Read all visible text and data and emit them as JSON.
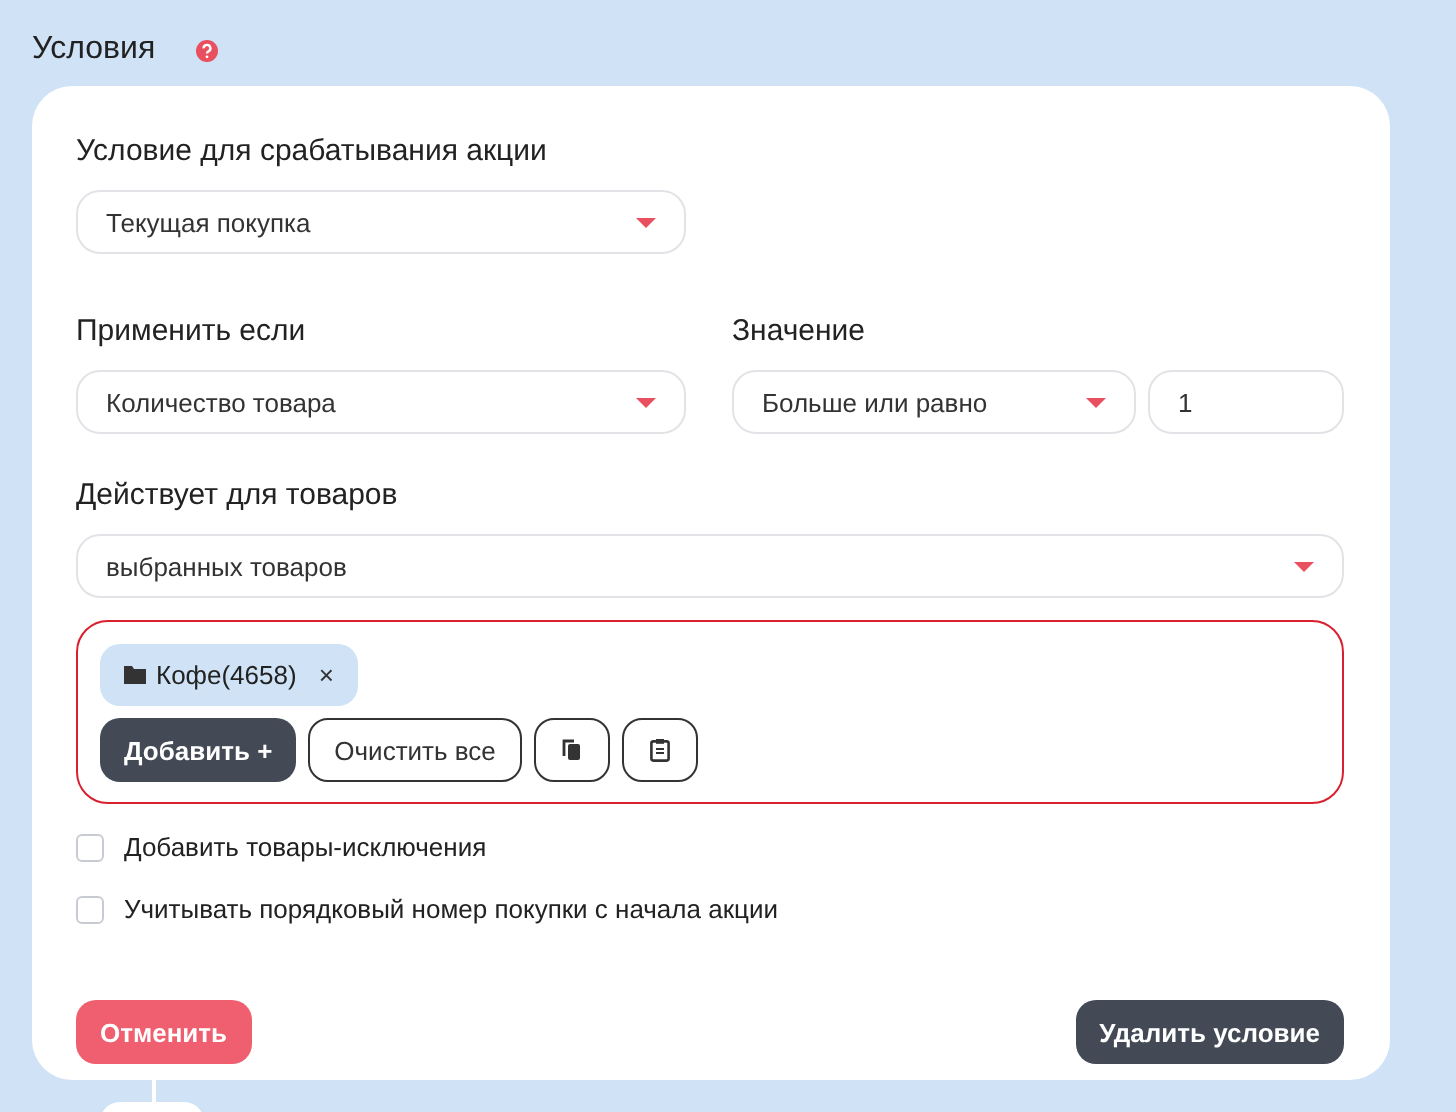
{
  "section": {
    "title": "Условия"
  },
  "trigger": {
    "label": "Условие для срабатывания акции",
    "value": "Текущая покупка"
  },
  "apply_if": {
    "label": "Применить если",
    "value": "Количество товара"
  },
  "value": {
    "label": "Значение",
    "operator": "Больше или равно",
    "amount": "1"
  },
  "products": {
    "label": "Действует для товаров",
    "value": "выбранных товаров",
    "tags": [
      {
        "text": "Кофе(4658)",
        "remove": "×"
      }
    ],
    "add_button": "Добавить +",
    "clear_button": "Очистить все"
  },
  "options": [
    {
      "label": "Добавить товары-исключения",
      "checked": false
    },
    {
      "label": "Учитывать порядковый номер покупки с начала акции",
      "checked": false
    }
  ],
  "cancel_button": "Отменить",
  "delete_button": "Удалить условие"
}
